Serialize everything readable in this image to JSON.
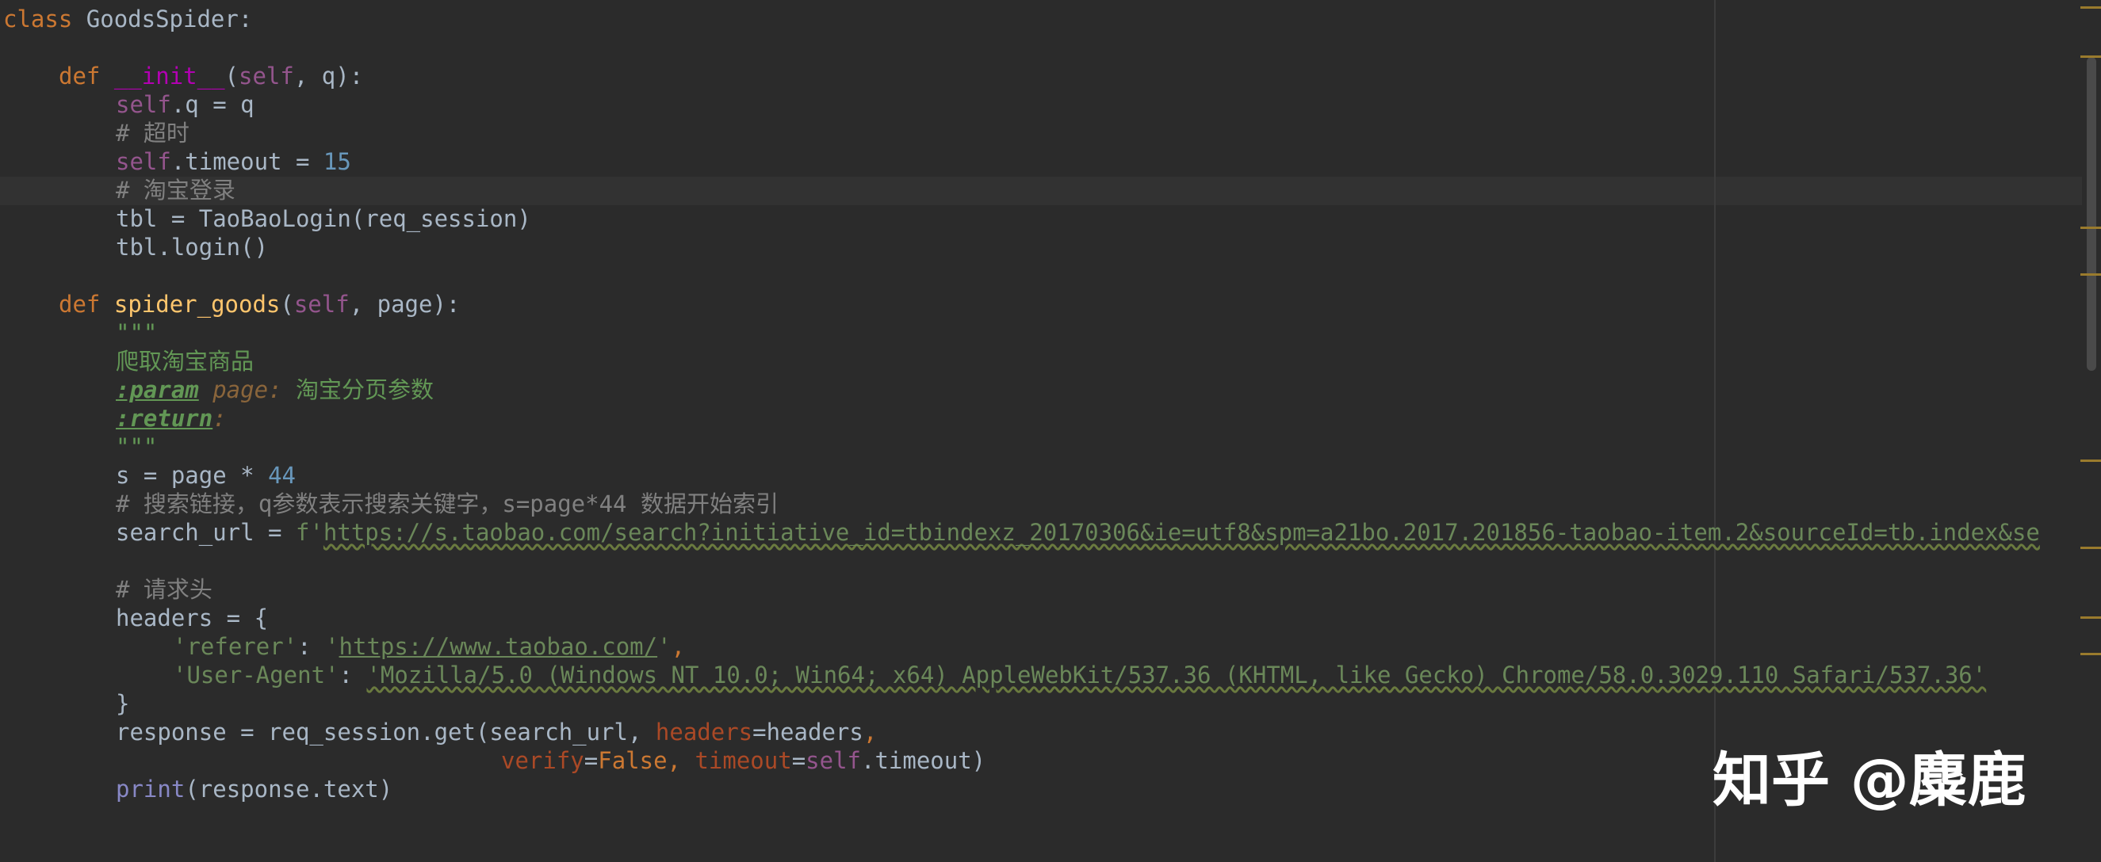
{
  "code": {
    "l1": {
      "kw": "class",
      "name": " GoodsSpider:"
    },
    "l3": {
      "kw": "def",
      "fn": "__init__",
      "open": "(",
      "self": "self",
      "rest": ", q):"
    },
    "l4": {
      "self": "self",
      "rest": ".q = q"
    },
    "l5": {
      "comment": "# 超时"
    },
    "l6": {
      "self": "self",
      "rest": ".timeout = ",
      "num": "15"
    },
    "l7": {
      "comment": "# 淘宝登录"
    },
    "l8": {
      "text": "tbl = TaoBaoLogin(req_session)"
    },
    "l9": {
      "text": "tbl.login()"
    },
    "l11": {
      "kw": "def",
      "fn": "spider_goods",
      "open": "(",
      "self": "self",
      "rest": ", page):"
    },
    "l12": {
      "doc": "\"\"\""
    },
    "l13": {
      "doc": "爬取淘宝商品"
    },
    "l14": {
      "tag": ":param",
      "param": " page:",
      "doc": " 淘宝分页参数"
    },
    "l15": {
      "tag": ":return",
      "colon": ":"
    },
    "l16": {
      "doc": "\"\"\""
    },
    "l17": {
      "text": "s = page * ",
      "num": "44"
    },
    "l18": {
      "comment": "# 搜索链接，q参数表示搜索关键字，s=page*44 数据开始索引"
    },
    "l19": {
      "text": "search_url = ",
      "prefix": "f'",
      "url": "https://s.taobao.com/search?initiative_id=tbindexz_20170306&ie=utf8&spm=a21bo.2017.201856-taobao-item.2&sourceId=tb.index&se"
    },
    "l21": {
      "comment": "# 请求头"
    },
    "l22": {
      "text": "headers = {"
    },
    "l23": {
      "key": "'referer'",
      "sep": ": ",
      "q1": "'",
      "val": "https://www.taobao.com/",
      "q2": "'",
      "comma": ","
    },
    "l24": {
      "key": "'User-Agent'",
      "sep": ": ",
      "val": "'Mozilla/5.0 (Windows NT 10.0; Win64; x64) AppleWebKit/537.36 (KHTML, like Gecko) Chrome/58.0.3029.110 Safari/537.36'"
    },
    "l25": {
      "text": "}"
    },
    "l26": {
      "text": "response = req_session.get(search_url, ",
      "kwarg": "headers",
      "rest": "=headers",
      "comma": ","
    },
    "l27": {
      "kwarg1": "verify",
      "eq1": "=",
      "kw": "False",
      "comma": ", ",
      "kwarg2": "timeout",
      "eq2": "=",
      "self": "self",
      "rest": ".timeout)"
    },
    "l28": {
      "builtin": "print",
      "rest": "(response.text)"
    }
  },
  "watermark": {
    "text": "知乎 @麋鹿"
  }
}
